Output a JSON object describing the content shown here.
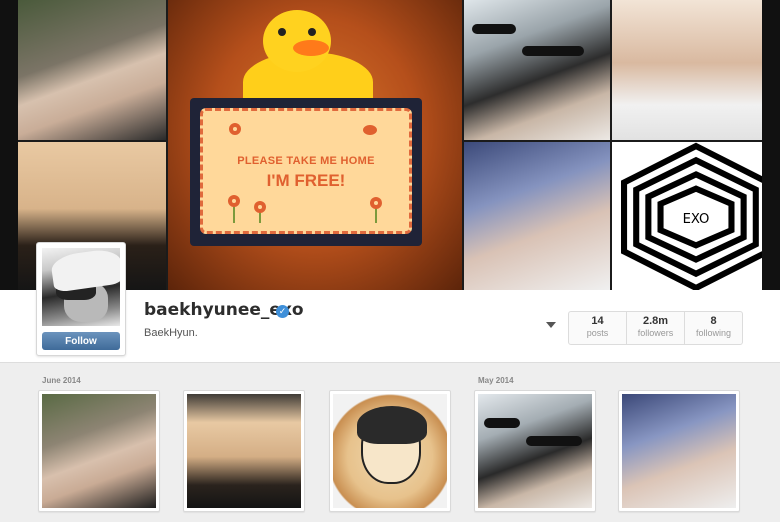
{
  "header": {
    "card_line1": "PLEASE TAKE ME HOME",
    "card_line2": "I'M FREE!",
    "logo_text": "EXO"
  },
  "profile": {
    "username": "baekhyunee_exo",
    "verified_icon": "✓",
    "full_name": "BaekHyun.",
    "follow_label": "Follow"
  },
  "stats": [
    {
      "value": "14",
      "label": "posts"
    },
    {
      "value": "2.8m",
      "label": "followers"
    },
    {
      "value": "8",
      "label": "following"
    }
  ],
  "grid": {
    "months": [
      {
        "label": "June 2014"
      },
      {
        "label": "May 2014"
      }
    ],
    "thumbnails": [
      {
        "subject": "selfie"
      },
      {
        "subject": "hat-selfie"
      },
      {
        "subject": "cookie-portrait"
      },
      {
        "subject": "sunglasses-duo"
      },
      {
        "subject": "duo-selfie"
      }
    ]
  },
  "colors": {
    "follow_button": "#4a76a5",
    "verified_badge": "#3e8fd9",
    "card_text": "#e0602f"
  }
}
